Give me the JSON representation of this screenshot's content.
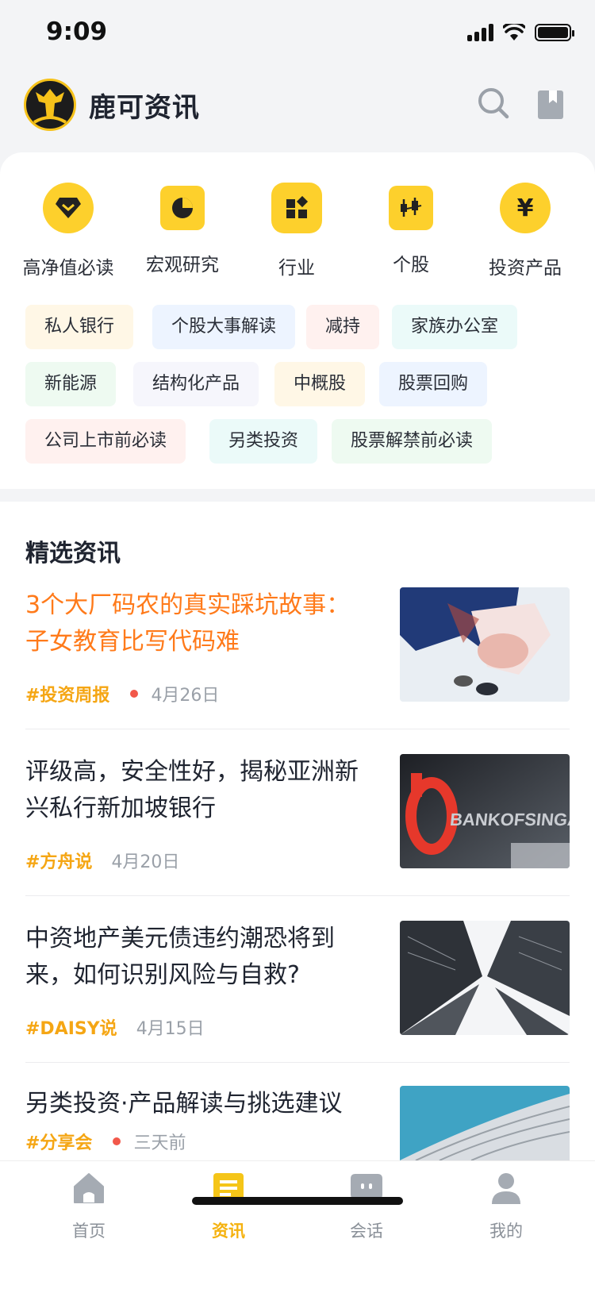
{
  "status_bar": {
    "time": "9:09"
  },
  "header": {
    "title": "鹿可资讯"
  },
  "categories": [
    {
      "label": "高净值必读",
      "icon": "diamond-icon"
    },
    {
      "label": "宏观研究",
      "icon": "pie-chart-icon"
    },
    {
      "label": "行业",
      "icon": "grid-blocks-icon"
    },
    {
      "label": "个股",
      "icon": "candlestick-icon"
    },
    {
      "label": "投资产品",
      "icon": "yen-icon"
    }
  ],
  "tags": [
    {
      "label": "私人银行",
      "color": "#fff7e6"
    },
    {
      "label": "个股大事解读",
      "color": "#edf4ff"
    },
    {
      "label": "减持",
      "color": "#fff1ef"
    },
    {
      "label": "家族办公室",
      "color": "#ebfaf9"
    },
    {
      "label": "新能源",
      "color": "#eefaf1"
    },
    {
      "label": "结构化产品",
      "color": "#f6f6fc"
    },
    {
      "label": "中概股",
      "color": "#fff7e6"
    },
    {
      "label": "股票回购",
      "color": "#edf4ff"
    },
    {
      "label": "公司上市前必读",
      "color": "#fff1ef"
    },
    {
      "label": "另类投资",
      "color": "#ebfaf9"
    },
    {
      "label": "股票解禁前必读",
      "color": "#eefaf1"
    }
  ],
  "section": {
    "title": "精选资讯"
  },
  "articles": [
    {
      "title": "3个大厂码农的真实踩坑故事：子女教育比写代码难",
      "tag": "#投资周报",
      "date": "4月26日",
      "has_dot": true,
      "highlight": true
    },
    {
      "title": "评级高，安全性好，揭秘亚洲新兴私行新加坡银行",
      "tag": "#方舟说",
      "date": "4月20日",
      "has_dot": false,
      "highlight": false,
      "thumb_text": "BANKOFSINGAPORE"
    },
    {
      "title": "中资地产美元债违约潮恐将到来，如何识别风险与自救?",
      "tag": "#DAISY说",
      "date": "4月15日",
      "has_dot": false,
      "highlight": false
    },
    {
      "title": "另类投资·产品解读与挑选建议",
      "tag": "#分享会",
      "date": "三天前",
      "has_dot": true,
      "highlight": false
    }
  ],
  "tab_bar": {
    "items": [
      {
        "label": "首页",
        "icon": "home-icon",
        "active": false
      },
      {
        "label": "资讯",
        "icon": "news-icon",
        "active": true
      },
      {
        "label": "会话",
        "icon": "chat-icon",
        "active": false
      },
      {
        "label": "我的",
        "icon": "profile-icon",
        "active": false
      }
    ]
  },
  "colors": {
    "accent": "#f5b20f",
    "highlight": "#ff7a1a",
    "dot": "#f2584a"
  }
}
